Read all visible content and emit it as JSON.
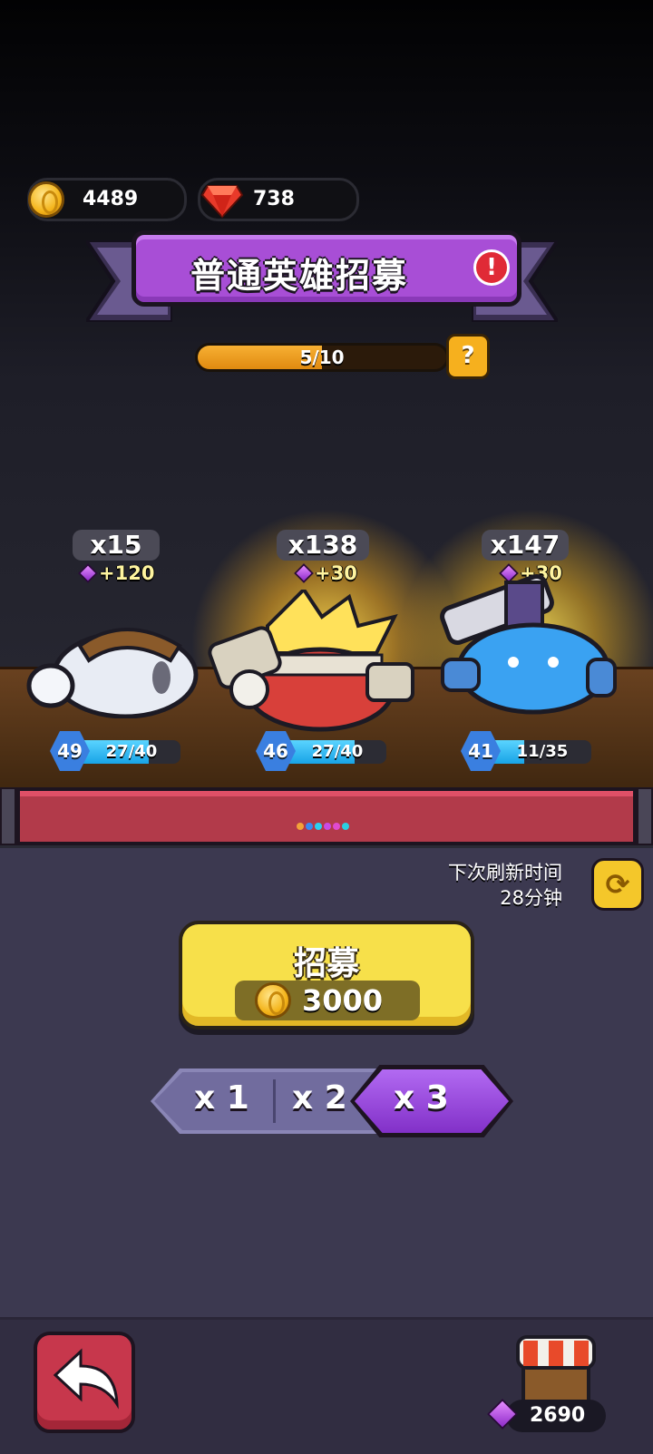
{
  "currency": {
    "gold": "4489",
    "rubies": "738"
  },
  "banner": {
    "title": "普通英雄招募",
    "alert_symbol": "!"
  },
  "progress": {
    "text": "5/10",
    "fraction": 0.5,
    "help_symbol": "?"
  },
  "heroes": [
    {
      "count": "x15",
      "bonus": "+120",
      "level": "49",
      "hp": "27/40",
      "hp_fraction": 0.675
    },
    {
      "count": "x138",
      "bonus": "+30",
      "level": "46",
      "hp": "27/40",
      "hp_fraction": 0.675
    },
    {
      "count": "x147",
      "bonus": "+30",
      "level": "41",
      "hp": "11/35",
      "hp_fraction": 0.314
    }
  ],
  "refresh": {
    "label": "下次刷新时间",
    "time": "28分钟"
  },
  "recruit": {
    "label": "招募",
    "cost": "3000"
  },
  "multiplier": {
    "options": [
      "x 1",
      "x 2",
      "x 3"
    ],
    "selected": "x 3"
  },
  "shop": {
    "gems": "2690"
  },
  "colors": {
    "accent_purple": "#a84ed6",
    "button_yellow": "#f7e04a",
    "back_red": "#c7374c"
  }
}
